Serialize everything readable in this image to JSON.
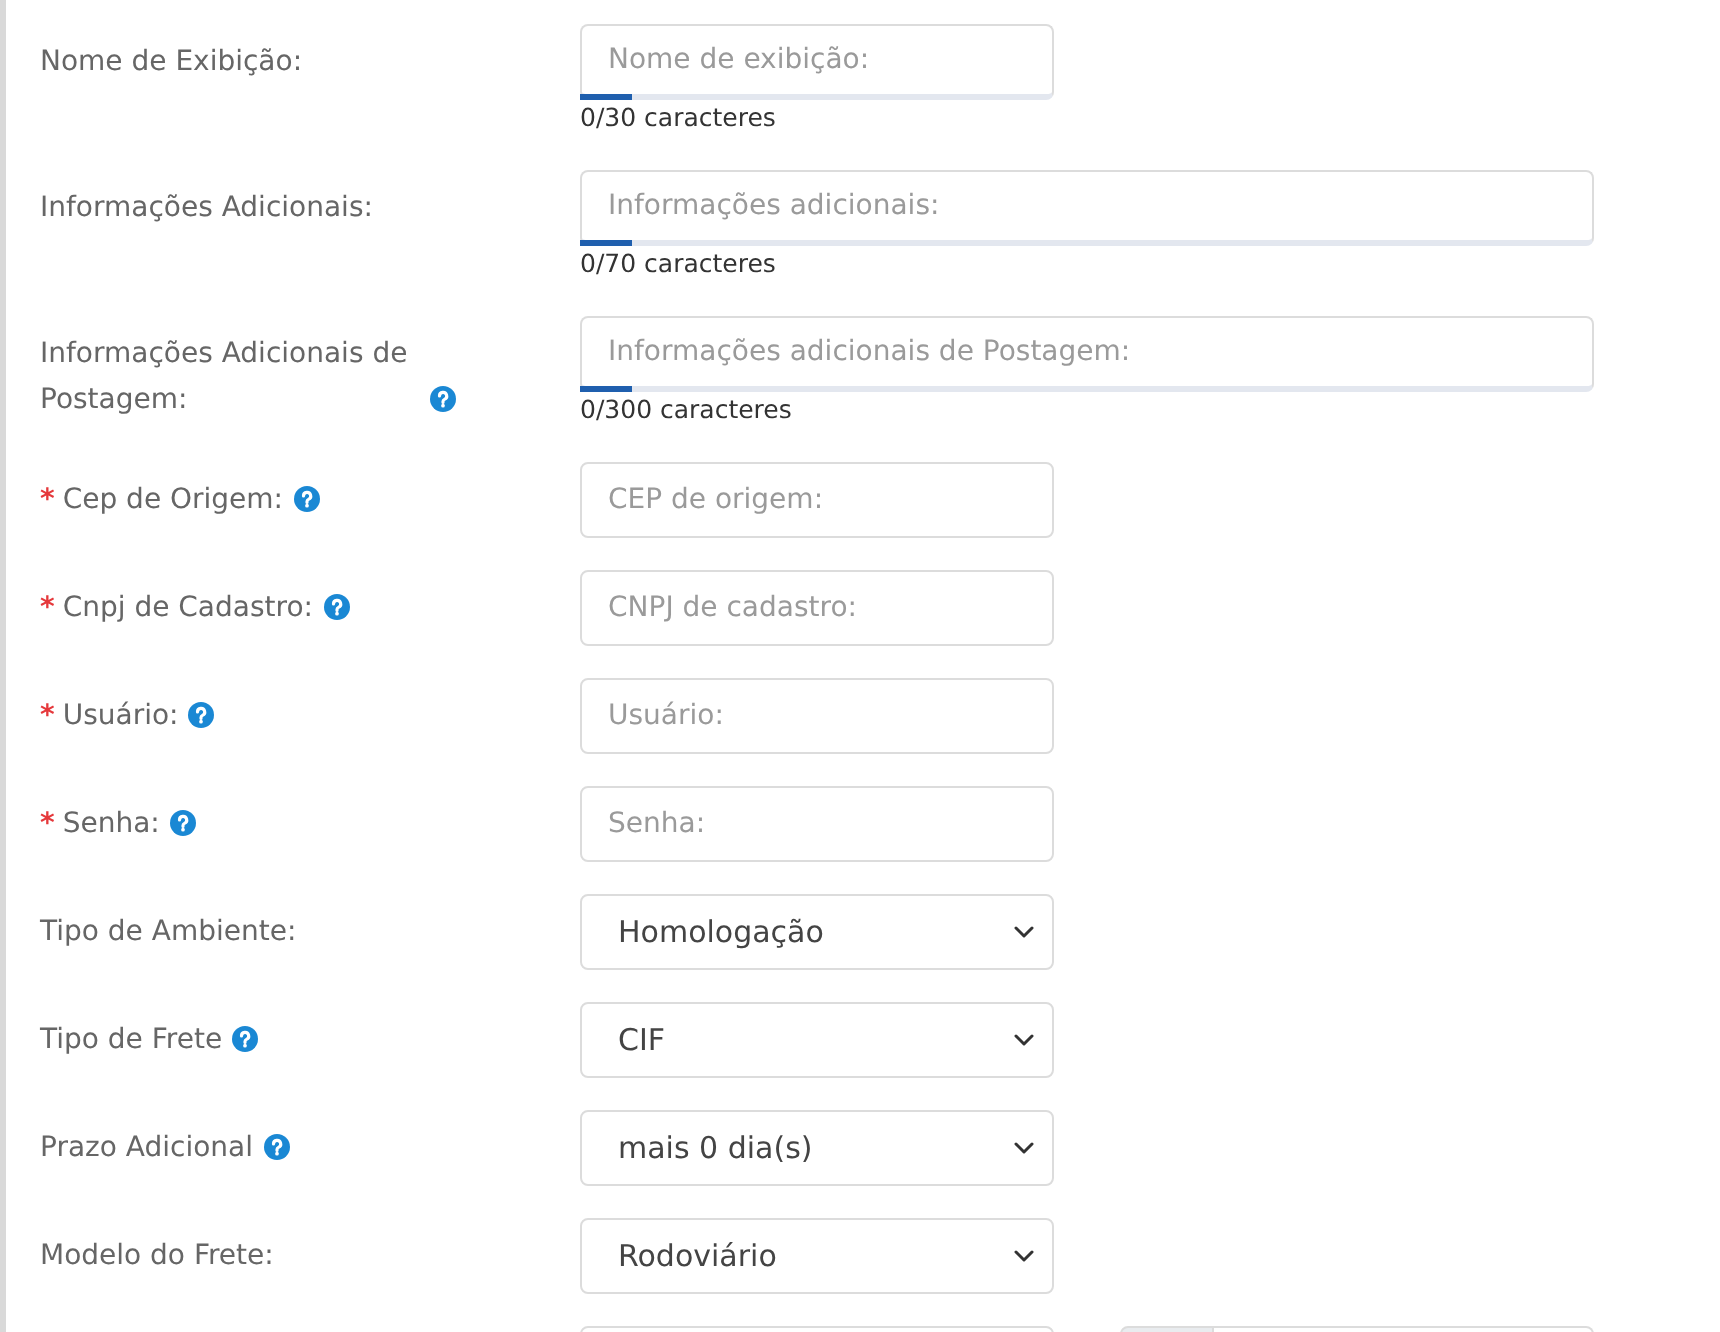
{
  "form": {
    "fields": [
      {
        "label": "Nome de Exibição:",
        "help": false,
        "kind": "input",
        "wide": false,
        "placeholder": "Nome de exibição:",
        "counter": "0/30 caracteres"
      },
      {
        "label": "Informações Adicionais:",
        "help": false,
        "kind": "input",
        "wide": true,
        "placeholder": "Informações adicionais:",
        "counter": "0/70 caracteres"
      },
      {
        "label": "Informações Adicionais de Postagem:",
        "help": true,
        "kind": "input",
        "wide": true,
        "placeholder": "Informações adicionais de Postagem:",
        "counter": "0/300 caracteres"
      },
      {
        "asterisk": "*",
        "label": "Cep de Origem:",
        "help": true,
        "kind": "input",
        "wide": false,
        "placeholder": "CEP de origem:"
      },
      {
        "asterisk": "*",
        "label": "Cnpj de Cadastro:",
        "help": true,
        "kind": "input",
        "wide": false,
        "placeholder": "CNPJ de cadastro:"
      },
      {
        "asterisk": "*",
        "label": "Usuário:",
        "help": true,
        "kind": "input",
        "wide": false,
        "placeholder": "Usuário:"
      },
      {
        "asterisk": "*",
        "label": "Senha:",
        "help": true,
        "kind": "input",
        "wide": false,
        "placeholder": "Senha:"
      },
      {
        "label": "Tipo de Ambiente:",
        "help": false,
        "kind": "select",
        "wide": false,
        "value": "Homologação"
      },
      {
        "label": "Tipo de Frete",
        "help": true,
        "kind": "select",
        "wide": false,
        "value": "CIF"
      },
      {
        "label": "Prazo Adicional",
        "help": true,
        "kind": "select",
        "wide": false,
        "value": "mais 0 dia(s)"
      },
      {
        "label": "Modelo do Frete:",
        "help": false,
        "kind": "select",
        "wide": false,
        "value": "Rodoviário"
      }
    ],
    "cut_off_row": [
      {
        "kind": "field"
      },
      {
        "kind": "addon_field"
      }
    ]
  }
}
